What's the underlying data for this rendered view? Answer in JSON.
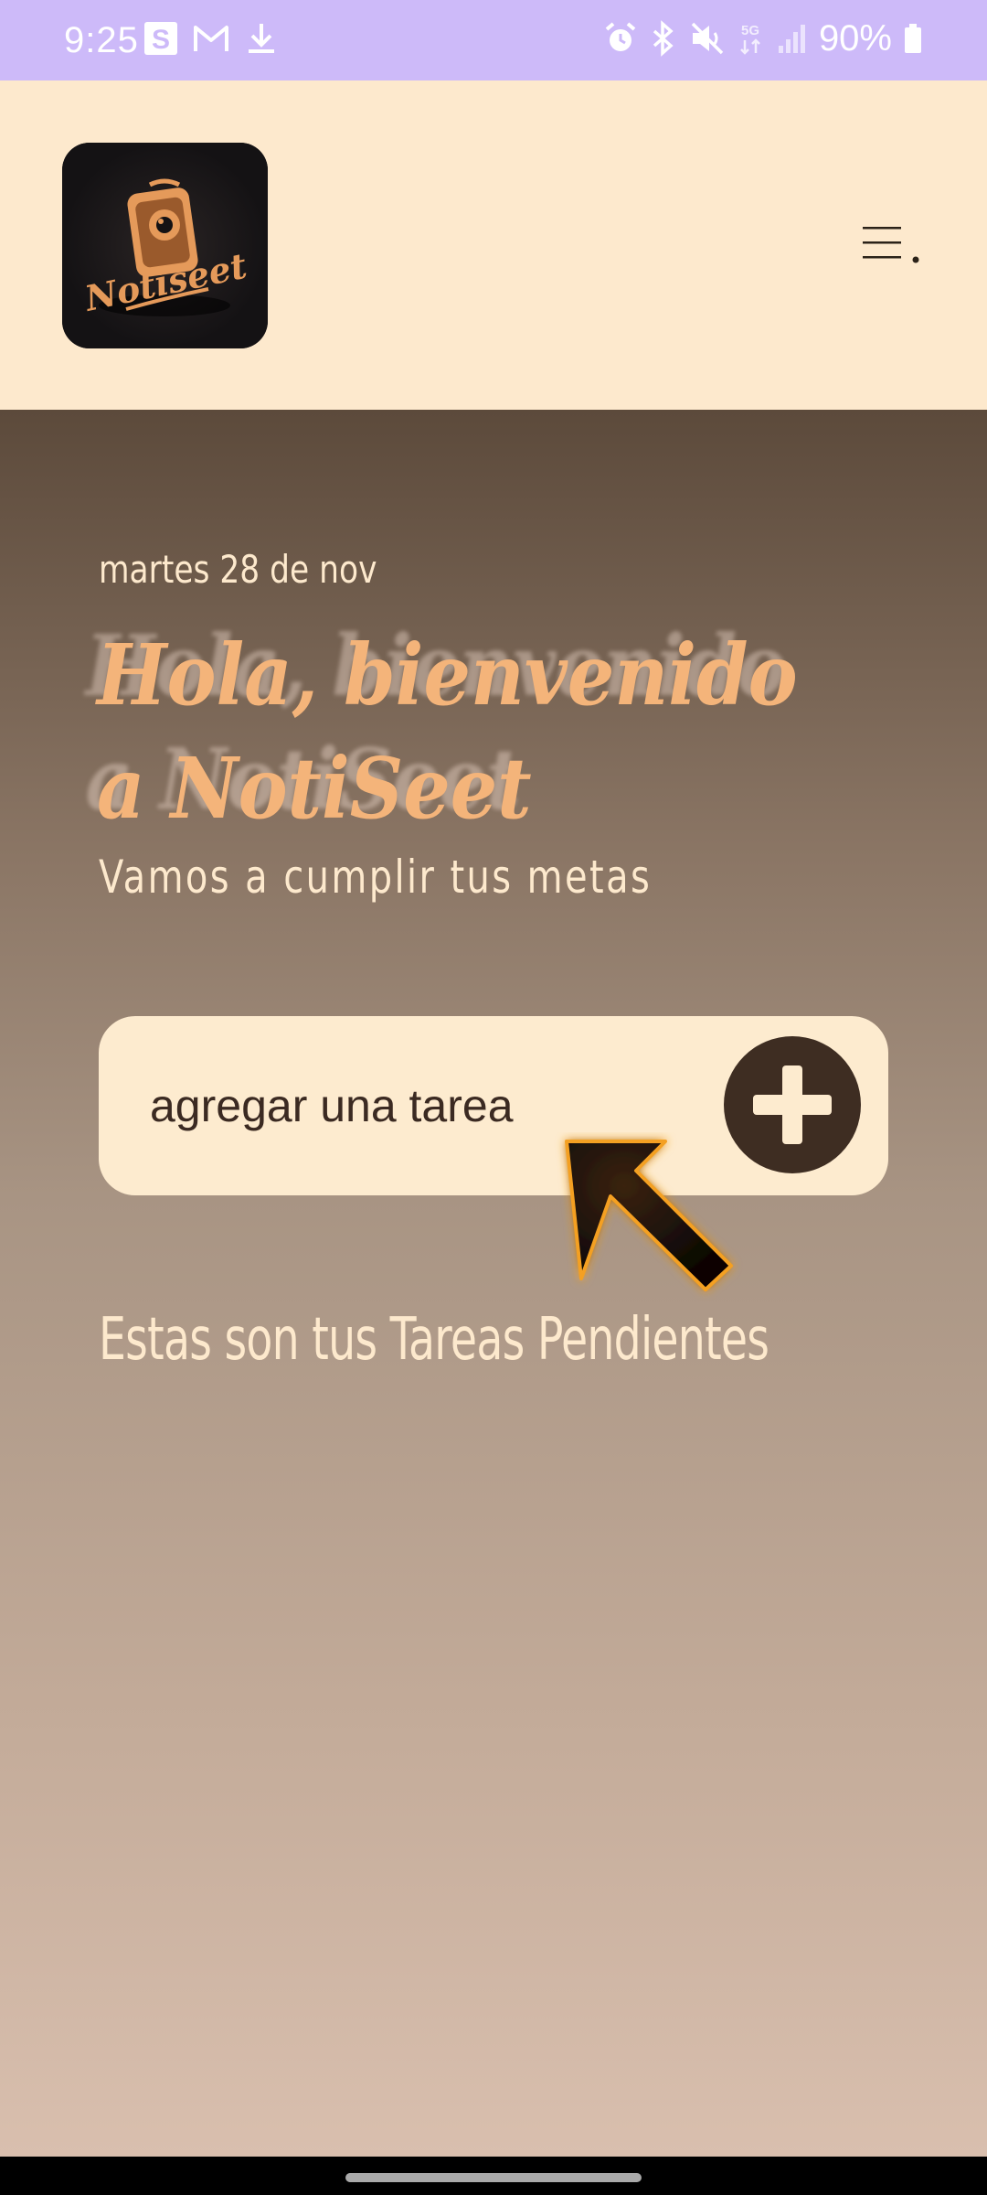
{
  "status_bar": {
    "time": "9:25",
    "battery": "90%",
    "network": "5G",
    "left_icons": [
      "s-app-icon",
      "gmail-icon",
      "download-icon"
    ],
    "right_icons": [
      "alarm-icon",
      "bluetooth-icon",
      "mute-icon",
      "5g-icon",
      "signal-icon",
      "battery-icon"
    ],
    "background": "#cdbaf9"
  },
  "header": {
    "logo_text": "Notiseet",
    "background": "#fde9cd",
    "logo_background": "#141214",
    "logo_accent": "#e59a5a"
  },
  "hero": {
    "date": "martes 28 de nov",
    "greeting": "Hola, bienvenido a NotiSeet",
    "subtitle": "Vamos a cumplir tus metas",
    "greeting_color": "#f4b47a"
  },
  "task_input": {
    "placeholder": "agregar una tarea",
    "value": ""
  },
  "add_button": {
    "icon": "plus-icon",
    "background": "#3e2d22"
  },
  "pending": {
    "title": "Estas son tus Tareas Pendientes",
    "tasks": []
  }
}
